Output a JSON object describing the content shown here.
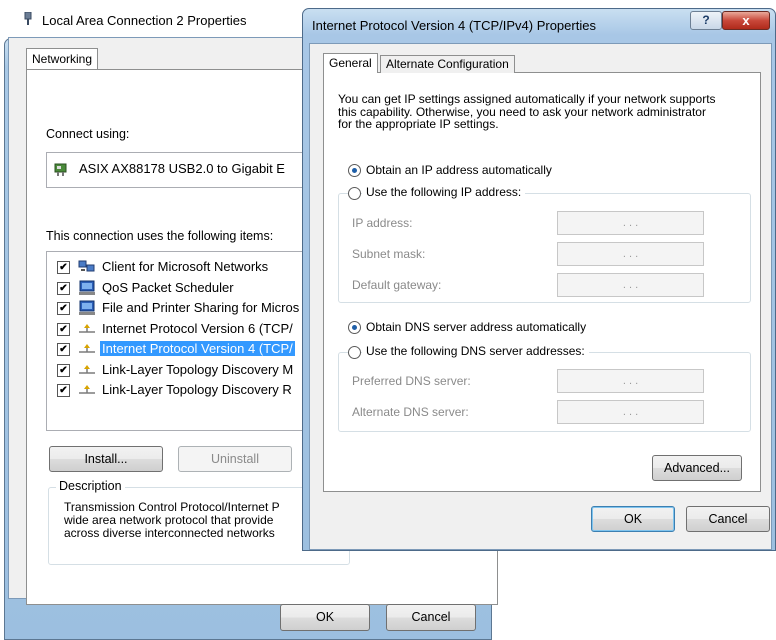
{
  "back_dialog": {
    "title": "Local Area Connection 2 Properties",
    "tab": "Networking",
    "connect_using_label": "Connect using:",
    "adapter_name": "ASIX AX88178 USB2.0 to Gigabit E",
    "items_label": "This connection uses the following items:",
    "items": [
      {
        "label": "Client for Microsoft Networks",
        "checked": true,
        "icon": "network-client-icon"
      },
      {
        "label": "QoS Packet Scheduler",
        "checked": true,
        "icon": "service-icon"
      },
      {
        "label": "File and Printer Sharing for Micros",
        "checked": true,
        "icon": "service-icon"
      },
      {
        "label": "Internet Protocol Version 6 (TCP/",
        "checked": true,
        "icon": "protocol-icon"
      },
      {
        "label": "Internet Protocol Version 4 (TCP/",
        "checked": true,
        "icon": "protocol-icon",
        "selected": true
      },
      {
        "label": "Link-Layer Topology Discovery M",
        "checked": true,
        "icon": "protocol-icon"
      },
      {
        "label": "Link-Layer Topology Discovery R",
        "checked": true,
        "icon": "protocol-icon"
      }
    ],
    "install_label": "Install...",
    "uninstall_label": "Uninstall",
    "description_title": "Description",
    "description_lines": [
      "Transmission Control Protocol/Internet P",
      "wide area network protocol that provide",
      "across diverse interconnected networks"
    ],
    "ok_label": "OK",
    "cancel_label": "Cancel"
  },
  "front_dialog": {
    "title": "Internet Protocol Version 4 (TCP/IPv4) Properties",
    "help_label": "?",
    "close_label": "x",
    "tabs": [
      "General",
      "Alternate Configuration"
    ],
    "intro_lines": [
      "You can get IP settings assigned automatically if your network supports",
      "this capability. Otherwise, you need to ask your network administrator",
      "for the appropriate IP settings."
    ],
    "obtain_ip_auto": "Obtain an IP address automatically",
    "use_following_ip": "Use the following IP address:",
    "ip_address_label": "IP address:",
    "subnet_mask_label": "Subnet mask:",
    "default_gateway_label": "Default gateway:",
    "obtain_dns_auto": "Obtain DNS server address automatically",
    "use_following_dns": "Use the following DNS server addresses:",
    "preferred_dns_label": "Preferred DNS server:",
    "alternate_dns_label": "Alternate DNS server:",
    "ip_placeholder": ".       .       .",
    "advanced_label": "Advanced...",
    "ok_label": "OK",
    "cancel_label": "Cancel"
  }
}
